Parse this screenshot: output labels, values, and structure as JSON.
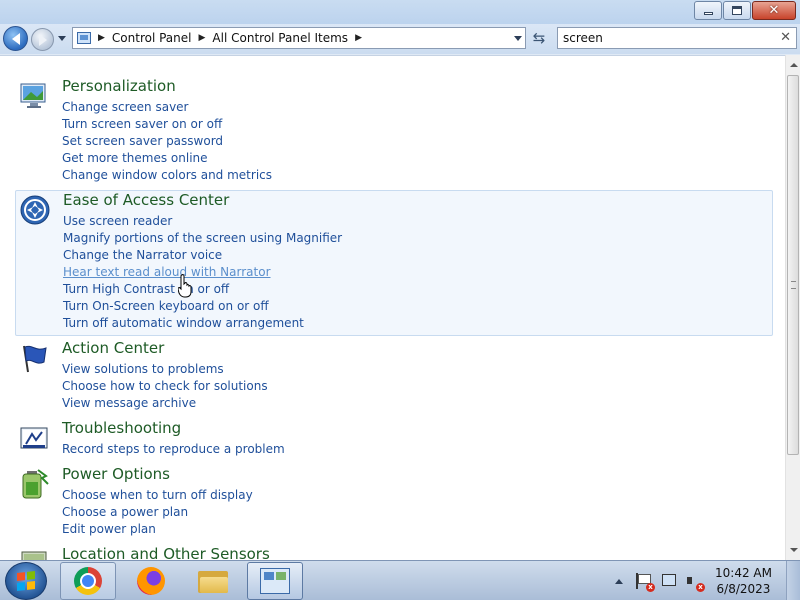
{
  "window": {
    "minimize_glyph": "",
    "maximize_glyph": "",
    "close_glyph": "✕"
  },
  "address": {
    "crumbs": [
      "Control Panel",
      "All Control Panel Items"
    ],
    "separator": "▶"
  },
  "search": {
    "value": "screen",
    "clear_glyph": "✕"
  },
  "refresh_glyph": "⇆",
  "groups": [
    {
      "title": "Personalization",
      "icon": "personalization-icon",
      "links": [
        "Change screen saver",
        "Turn screen saver on or off",
        "Set screen saver password",
        "Get more themes online",
        "Change window colors and metrics"
      ]
    },
    {
      "title": "Ease of Access Center",
      "icon": "ease-of-access-icon",
      "selected": true,
      "links": [
        "Use screen reader",
        "Magnify portions of the screen using Magnifier",
        "Change the Narrator voice",
        "Hear text read aloud with Narrator",
        "Turn High Contrast on or off",
        "Turn On-Screen keyboard on or off",
        "Turn off automatic window arrangement"
      ],
      "hovered_link": 3
    },
    {
      "title": "Action Center",
      "icon": "action-center-flag-icon",
      "links": [
        "View solutions to problems",
        "Choose how to check for solutions",
        "View message archive"
      ]
    },
    {
      "title": "Troubleshooting",
      "icon": "troubleshooting-icon",
      "links": [
        "Record steps to reproduce a problem"
      ]
    },
    {
      "title": "Power Options",
      "icon": "power-options-battery-icon",
      "links": [
        "Choose when to turn off display",
        "Choose a power plan",
        "Edit power plan"
      ]
    },
    {
      "title": "Location and Other Sensors",
      "icon": "location-sensors-icon",
      "links": []
    }
  ],
  "taskbar": {
    "items": [
      {
        "name": "chrome",
        "icon": "chrome-icon",
        "state": "running"
      },
      {
        "name": "firefox",
        "icon": "firefox-icon",
        "state": "idle"
      },
      {
        "name": "explorer",
        "icon": "folder-icon",
        "state": "idle"
      },
      {
        "name": "control-panel",
        "icon": "control-panel-icon",
        "state": "active"
      }
    ],
    "clock_time": "10:42 AM",
    "clock_date": "6/8/2023"
  },
  "colors": {
    "group_title": "#1e5b26",
    "link": "#1f4f9a",
    "link_hover": "#5b8fcc",
    "selection_bg": "#f2f7fd"
  }
}
